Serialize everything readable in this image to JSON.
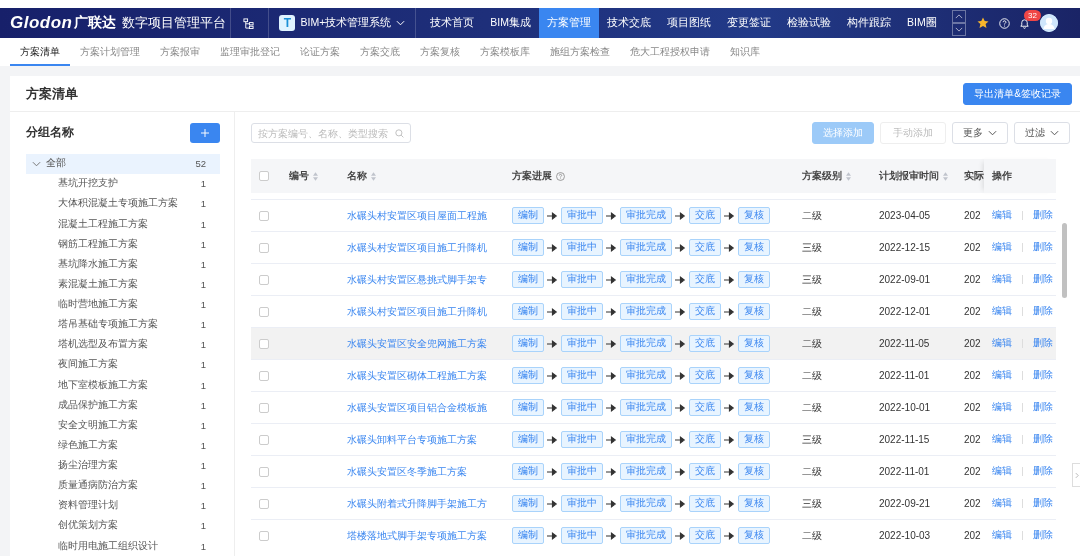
{
  "header": {
    "logo": "Glodon",
    "brand": "广联达",
    "platform": "数字项目管理平台",
    "system_badge": "T",
    "system": "BIM+技术管理系统",
    "nav": [
      {
        "label": "技术首页",
        "selected": false
      },
      {
        "label": "BIM集成",
        "selected": false
      },
      {
        "label": "方案管理",
        "selected": true
      },
      {
        "label": "技术交底",
        "selected": false
      },
      {
        "label": "项目图纸",
        "selected": false
      },
      {
        "label": "变更签证",
        "selected": false
      },
      {
        "label": "检验试验",
        "selected": false
      },
      {
        "label": "构件跟踪",
        "selected": false
      },
      {
        "label": "BIM圈",
        "selected": false
      }
    ],
    "notification_count": "32"
  },
  "subtabs": [
    {
      "label": "方案清单",
      "selected": true
    },
    {
      "label": "方案计划管理",
      "selected": false
    },
    {
      "label": "方案报审",
      "selected": false
    },
    {
      "label": "监理审批登记",
      "selected": false
    },
    {
      "label": "论证方案",
      "selected": false
    },
    {
      "label": "方案交底",
      "selected": false
    },
    {
      "label": "方案复核",
      "selected": false
    },
    {
      "label": "方案模板库",
      "selected": false
    },
    {
      "label": "施组方案检查",
      "selected": false
    },
    {
      "label": "危大工程授权申请",
      "selected": false
    },
    {
      "label": "知识库",
      "selected": false
    }
  ],
  "page_title": "方案清单",
  "export_button": "导出清单&签收记录",
  "groups": {
    "title": "分组名称",
    "tree": [
      {
        "label": "全部",
        "count": "52",
        "expanded": true,
        "selected": true,
        "children": [
          {
            "label": "基坑开挖支护",
            "count": "1",
            "selected": false
          },
          {
            "label": "大体积混凝土专项施工方案",
            "count": "1",
            "selected": false
          },
          {
            "label": "混凝土工程施工方案",
            "count": "1",
            "selected": false
          },
          {
            "label": "钢筋工程施工方案",
            "count": "1",
            "selected": false
          },
          {
            "label": "基坑降水施工方案",
            "count": "1",
            "selected": false
          },
          {
            "label": "素混凝土施工方案",
            "count": "1",
            "selected": false
          },
          {
            "label": "临时营地施工方案",
            "count": "1",
            "selected": false
          },
          {
            "label": "塔吊基础专项施工方案",
            "count": "1",
            "selected": false
          },
          {
            "label": "塔机选型及布置方案",
            "count": "1",
            "selected": false
          },
          {
            "label": "夜间施工方案",
            "count": "1",
            "selected": false
          },
          {
            "label": "地下室模板施工方案",
            "count": "1",
            "selected": false
          },
          {
            "label": "成品保护施工方案",
            "count": "1",
            "selected": false
          },
          {
            "label": "安全文明施工方案",
            "count": "1",
            "selected": false
          },
          {
            "label": "绿色施工方案",
            "count": "1",
            "selected": false
          },
          {
            "label": "扬尘治理方案",
            "count": "1",
            "selected": false
          },
          {
            "label": "质量通病防治方案",
            "count": "1",
            "selected": false
          },
          {
            "label": "资料管理计划",
            "count": "1",
            "selected": false
          },
          {
            "label": "创优策划方案",
            "count": "1",
            "selected": false
          },
          {
            "label": "临时用电施工组织设计",
            "count": "1",
            "selected": false
          }
        ]
      }
    ]
  },
  "toolbar": {
    "search": {
      "placeholder": "按方案编号、名称、类型搜索"
    },
    "buttons": [
      {
        "label": "选择添加",
        "kind": "primary",
        "disabled": true
      },
      {
        "label": "手动添加",
        "kind": "default",
        "disabled": true
      },
      {
        "label": "更多",
        "kind": "dropdown",
        "disabled": false
      },
      {
        "label": "过滤",
        "kind": "dropdown",
        "disabled": false
      }
    ]
  },
  "table": {
    "all_checked": false,
    "columns": [
      {
        "label": "编号",
        "kind": "sort"
      },
      {
        "label": "名称",
        "kind": "sort"
      },
      {
        "label": "方案进展",
        "kind": "help"
      },
      {
        "label": "方案级别",
        "kind": "sort"
      },
      {
        "label": "计划报审时间",
        "kind": "sort"
      },
      {
        "label": "实际",
        "kind": "plain"
      },
      {
        "label": "操作",
        "kind": "plain"
      }
    ],
    "rows": [
      {
        "checked": false,
        "highlighted": false,
        "name": "水碾头村安置区项目屋面工程施",
        "progress": [
          "编制",
          "审批中",
          "审批完成",
          "交底",
          "复核"
        ],
        "level": "二级",
        "planned": "2023-04-05",
        "actual": "202",
        "actions": [
          "编辑",
          "删除"
        ]
      },
      {
        "checked": false,
        "highlighted": false,
        "name": "水碾头村安置区项目施工升降机",
        "progress": [
          "编制",
          "审批中",
          "审批完成",
          "交底",
          "复核"
        ],
        "level": "三级",
        "planned": "2022-12-15",
        "actual": "202",
        "actions": [
          "编辑",
          "删除"
        ]
      },
      {
        "checked": false,
        "highlighted": false,
        "name": "水碾头村安置区悬挑式脚手架专",
        "progress": [
          "编制",
          "审批中",
          "审批完成",
          "交底",
          "复核"
        ],
        "level": "三级",
        "planned": "2022-09-01",
        "actual": "202",
        "actions": [
          "编辑",
          "删除"
        ]
      },
      {
        "checked": false,
        "highlighted": false,
        "name": "水碾头村安置区项目施工升降机",
        "progress": [
          "编制",
          "审批中",
          "审批完成",
          "交底",
          "复核"
        ],
        "level": "二级",
        "planned": "2022-12-01",
        "actual": "202",
        "actions": [
          "编辑",
          "删除"
        ]
      },
      {
        "checked": false,
        "highlighted": true,
        "name": "水碾头安置区安全兜网施工方案",
        "progress": [
          "编制",
          "审批中",
          "审批完成",
          "交底",
          "复核"
        ],
        "level": "二级",
        "planned": "2022-11-05",
        "actual": "202",
        "actions": [
          "编辑",
          "删除"
        ]
      },
      {
        "checked": false,
        "highlighted": false,
        "name": "水碾头安置区砌体工程施工方案",
        "progress": [
          "编制",
          "审批中",
          "审批完成",
          "交底",
          "复核"
        ],
        "level": "二级",
        "planned": "2022-11-01",
        "actual": "202",
        "actions": [
          "编辑",
          "删除"
        ]
      },
      {
        "checked": false,
        "highlighted": false,
        "name": "水碾头安置区项目铝合金模板施",
        "progress": [
          "编制",
          "审批中",
          "审批完成",
          "交底",
          "复核"
        ],
        "level": "二级",
        "planned": "2022-10-01",
        "actual": "202",
        "actions": [
          "编辑",
          "删除"
        ]
      },
      {
        "checked": false,
        "highlighted": false,
        "name": "水碾头卸料平台专项施工方案",
        "progress": [
          "编制",
          "审批中",
          "审批完成",
          "交底",
          "复核"
        ],
        "level": "三级",
        "planned": "2022-11-15",
        "actual": "202",
        "actions": [
          "编辑",
          "删除"
        ]
      },
      {
        "checked": false,
        "highlighted": false,
        "name": "水碾头安置区冬季施工方案",
        "progress": [
          "编制",
          "审批中",
          "审批完成",
          "交底",
          "复核"
        ],
        "level": "二级",
        "planned": "2022-11-01",
        "actual": "202",
        "actions": [
          "编辑",
          "删除"
        ]
      },
      {
        "checked": false,
        "highlighted": false,
        "name": "水碾头附着式升降脚手架施工方",
        "progress": [
          "编制",
          "审批中",
          "审批完成",
          "交底",
          "复核"
        ],
        "level": "三级",
        "planned": "2022-09-21",
        "actual": "202",
        "actions": [
          "编辑",
          "删除"
        ]
      },
      {
        "checked": false,
        "highlighted": false,
        "name": "塔楼落地式脚手架专项施工方案",
        "progress": [
          "编制",
          "审批中",
          "审批完成",
          "交底",
          "复核"
        ],
        "level": "二级",
        "planned": "2022-10-03",
        "actual": "202",
        "actions": [
          "编辑",
          "删除"
        ]
      }
    ]
  }
}
